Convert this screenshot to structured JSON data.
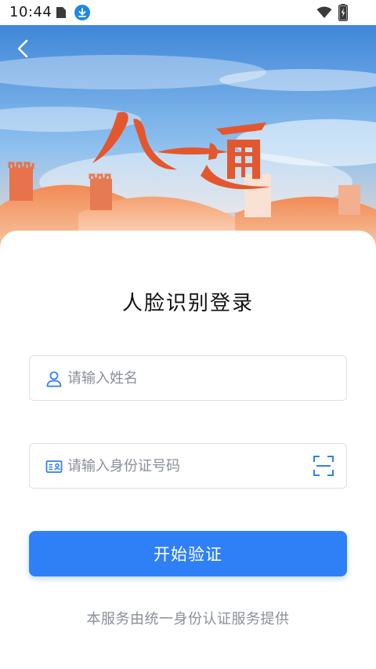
{
  "status_bar": {
    "time": "10:44",
    "icons": [
      "sim-card-icon",
      "download-icon",
      "wifi-icon",
      "battery-charging-icon"
    ]
  },
  "header": {
    "back_icon": "back-chevron-icon",
    "banner_title": "八一通"
  },
  "main": {
    "title": "人脸识别登录",
    "name_field": {
      "placeholder": "请输入姓名",
      "value": "",
      "icon": "user-icon"
    },
    "id_field": {
      "placeholder": "请输入身份证号码",
      "value": "",
      "icon": "id-card-icon",
      "action_icon": "scan-icon"
    },
    "start_button": "开始验证",
    "footer_note": "本服务由统一身份认证服务提供"
  },
  "colors": {
    "accent": "#2f80f7",
    "banner_sky": "#5aa3e6",
    "banner_red": "#e4572e",
    "placeholder_text": "#8a8f99",
    "field_border": "#dcdfe6"
  }
}
